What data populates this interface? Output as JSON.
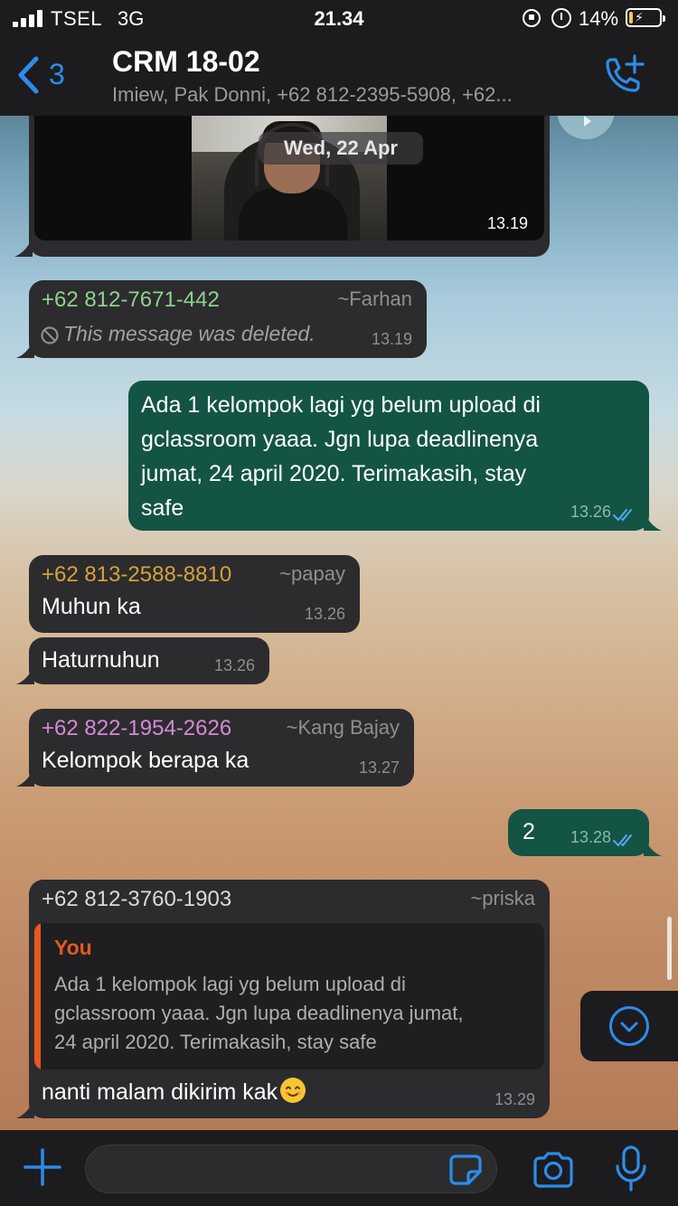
{
  "status_bar": {
    "carrier": "TSEL",
    "network": "3G",
    "time": "21.34",
    "battery_pct": "14%",
    "battery_level": 0.14,
    "signal_bars": 4
  },
  "header": {
    "back_count": "3",
    "title": "CRM 18-02",
    "subtitle": "Imiew, Pak Donni, +62 812-2395-5908, +62..."
  },
  "chat": {
    "date_chip": "Wed, 22 Apr",
    "media_message": {
      "time": "13.19"
    },
    "deleted_message": {
      "sender_number": "+62 812-7671-442",
      "sender_alias": "~Farhan",
      "sender_color": "#8fd18c",
      "text": "This message was deleted.",
      "time": "13.19"
    },
    "out_message_1": {
      "lines": [
        "Ada 1 kelompok lagi yg belum upload di",
        "gclassroom yaaa. Jgn lupa deadlinenya",
        "jumat, 24 april 2020. Terimakasih, stay",
        "safe"
      ],
      "time": "13.26"
    },
    "papay_message_1": {
      "sender_number": "+62 813-2588-8810",
      "sender_alias": "~papay",
      "sender_color": "#d4a23a",
      "text": "Muhun ka",
      "time": "13.26"
    },
    "papay_message_2": {
      "text": "Haturnuhun",
      "time": "13.26"
    },
    "bajay_message": {
      "sender_number": "+62 822-1954-2626",
      "sender_alias": "~Kang Bajay",
      "sender_color": "#d58ad6",
      "text": "Kelompok berapa ka",
      "time": "13.27"
    },
    "out_message_2": {
      "text": "2",
      "time": "13.28"
    },
    "priska_message": {
      "sender_number": "+62 812-3760-1903",
      "sender_alias": "~priska",
      "sender_color": "#d9d9de",
      "quote_name": "You",
      "quote_lines": [
        "Ada 1 kelompok lagi yg belum upload di",
        "gclassroom yaaa. Jgn lupa deadlinenya jumat,",
        "24 april 2020. Terimakasih, stay safe"
      ],
      "text": "nanti malam dikirim kak",
      "emoji": "smiling-face-emoji",
      "time": "13.29"
    }
  },
  "colors": {
    "accent": "#2d8ceb",
    "outgoing_bubble": "#135445",
    "incoming_bubble": "#2c2c2e",
    "read_ticks": "#53a9ef"
  },
  "icons": [
    "back-chevron-icon",
    "add-call-icon",
    "plus-icon",
    "sticker-icon",
    "camera-icon",
    "microphone-icon",
    "chevron-down-icon",
    "forward-icon",
    "deleted-icon",
    "double-check-icon"
  ]
}
